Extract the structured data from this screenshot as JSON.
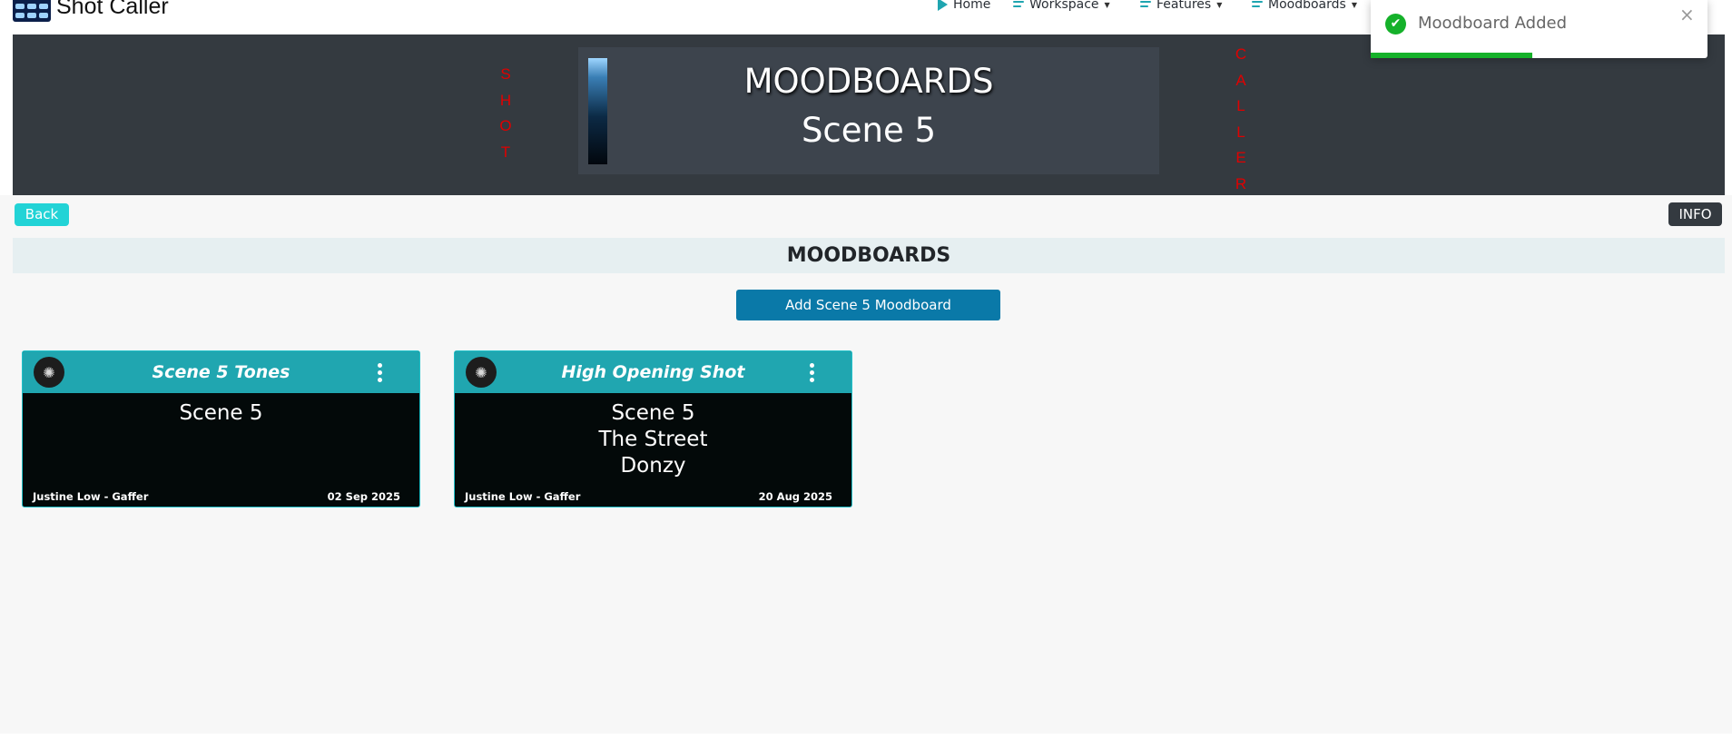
{
  "navbar": {
    "brand": "Shot Caller",
    "items": [
      {
        "label": "Home",
        "icon": "play-icon"
      },
      {
        "label": "Workspace",
        "icon": "menu-icon"
      },
      {
        "label": "Features",
        "icon": "menu-icon"
      },
      {
        "label": "Moodboards",
        "icon": "menu-icon"
      }
    ]
  },
  "hero": {
    "left_vertical": "SHOT",
    "right_vertical": "CALLER",
    "title": "MOODBOARDS",
    "subtitle": "Scene 5"
  },
  "actions": {
    "back": "Back",
    "info": "INFO",
    "add": "Add Scene 5 Moodboard"
  },
  "section_title": "MOODBOARDS",
  "cards": [
    {
      "title": "Scene 5 Tones",
      "body": [
        "Scene 5"
      ],
      "author": "Justine Low - Gaffer",
      "date": "02 Sep 2025"
    },
    {
      "title": "High Opening Shot",
      "body": [
        "Scene 5",
        "The Street",
        "Donzy"
      ],
      "author": "Justine Low - Gaffer",
      "date": "20 Aug 2025"
    }
  ],
  "toast": {
    "message": "Moodboard Added",
    "close": "×",
    "progress": 0.48
  },
  "colors": {
    "accent": "#20a6b0",
    "danger": "#e00000",
    "success": "#15b12a",
    "dark": "#343a40"
  }
}
